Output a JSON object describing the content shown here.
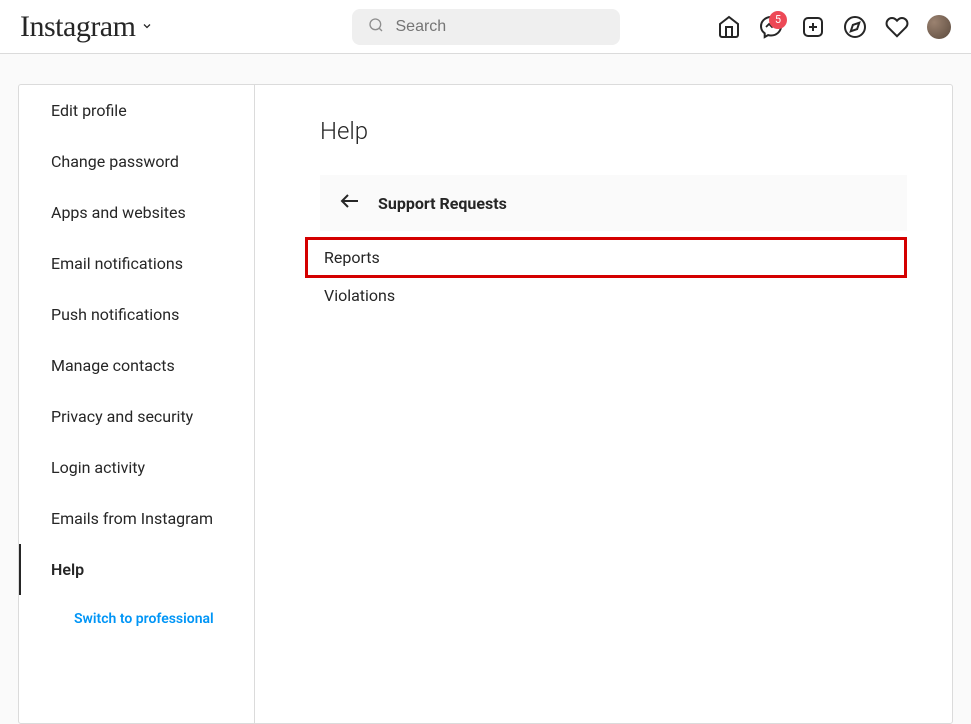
{
  "header": {
    "logo": "Instagram",
    "search_placeholder": "Search",
    "badge_count": "5"
  },
  "sidebar": {
    "items": [
      {
        "label": "Edit profile"
      },
      {
        "label": "Change password"
      },
      {
        "label": "Apps and websites"
      },
      {
        "label": "Email notifications"
      },
      {
        "label": "Push notifications"
      },
      {
        "label": "Manage contacts"
      },
      {
        "label": "Privacy and security"
      },
      {
        "label": "Login activity"
      },
      {
        "label": "Emails from Instagram"
      },
      {
        "label": "Help"
      }
    ],
    "switch_link": "Switch to professional"
  },
  "main": {
    "title": "Help",
    "support_header": "Support Requests",
    "rows": [
      {
        "label": "Reports"
      },
      {
        "label": "Violations"
      }
    ]
  }
}
